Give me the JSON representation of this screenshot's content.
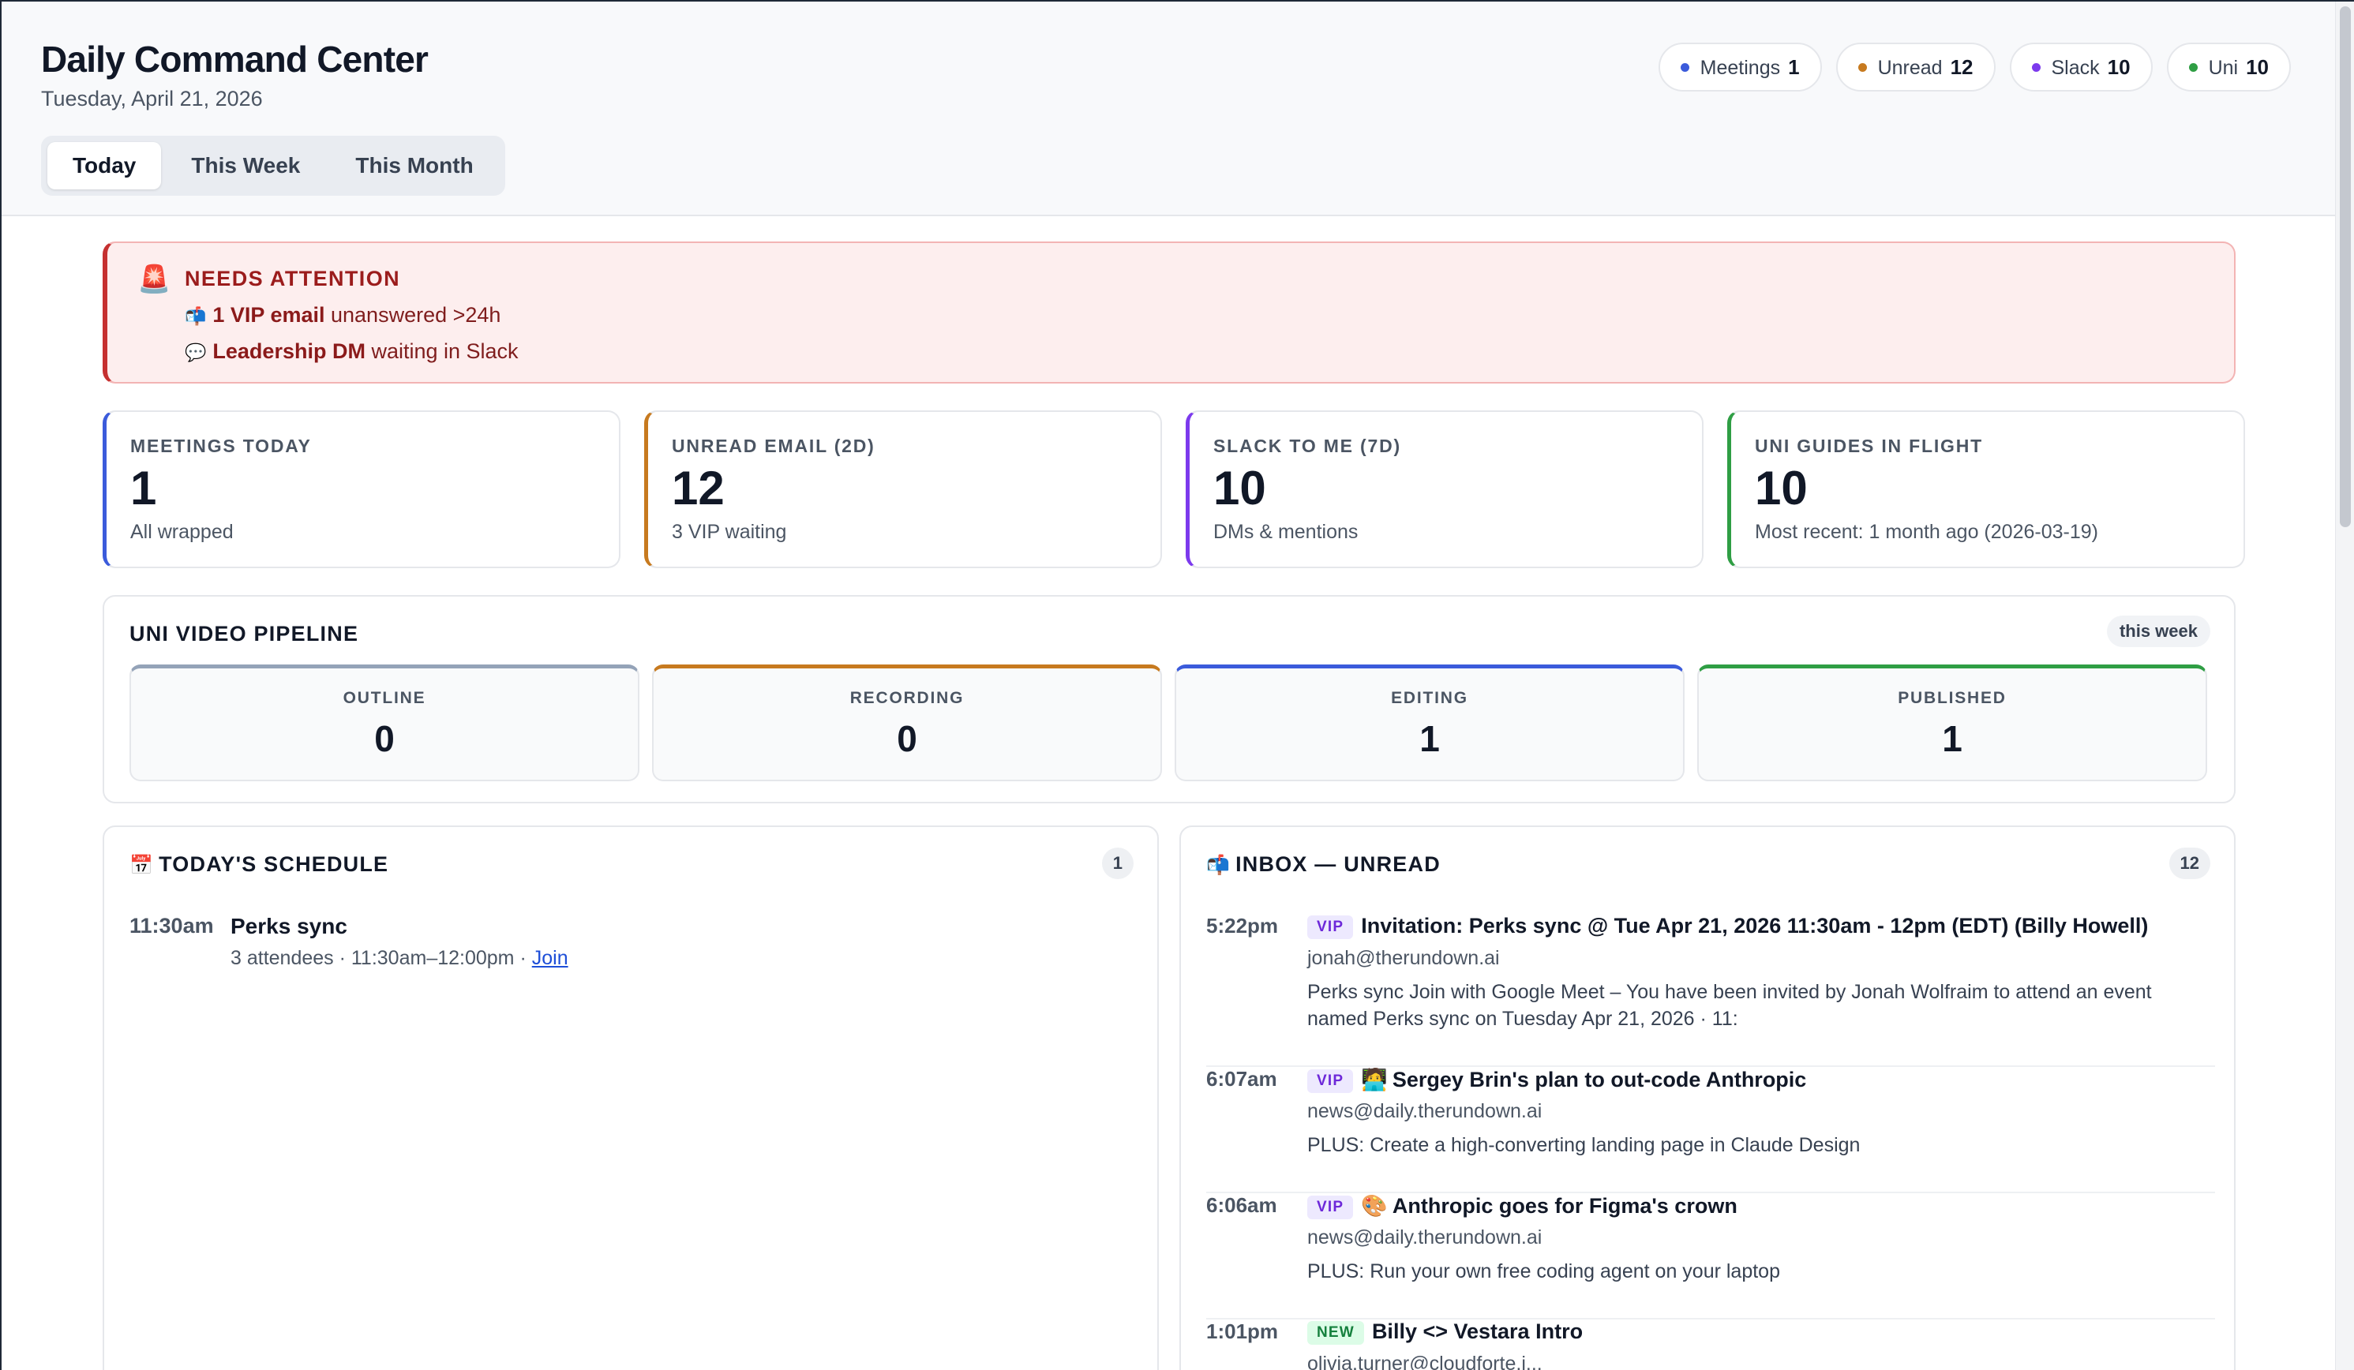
{
  "header": {
    "title": "Daily Command Center",
    "date": "Tuesday, April 21, 2026",
    "tabs": [
      {
        "label": "Today",
        "active": true
      },
      {
        "label": "This Week",
        "active": false
      },
      {
        "label": "This Month",
        "active": false
      }
    ],
    "pills": [
      {
        "label": "Meetings",
        "count": "1",
        "color": "#3b5bdb"
      },
      {
        "label": "Unread",
        "count": "12",
        "color": "#c77a1f"
      },
      {
        "label": "Slack",
        "count": "10",
        "color": "#7c3aed"
      },
      {
        "label": "Uni",
        "count": "10",
        "color": "#2f9e44"
      }
    ]
  },
  "alert": {
    "icon": "siren-icon",
    "title": "NEEDS ATTENTION",
    "lines": [
      {
        "icon": "mailbox-icon",
        "bold": "1 VIP email",
        "rest": " unanswered >24h"
      },
      {
        "icon": "speech-bubble-icon",
        "bold": "Leadership DM",
        "rest": " waiting in Slack"
      }
    ]
  },
  "metrics": [
    {
      "label": "MEETINGS TODAY",
      "value": "1",
      "sub": "All wrapped",
      "color": "#3b5bdb"
    },
    {
      "label": "UNREAD EMAIL (2D)",
      "value": "12",
      "sub": "3 VIP waiting",
      "color": "#c77a1f"
    },
    {
      "label": "SLACK TO ME (7D)",
      "value": "10",
      "sub": "DMs & mentions",
      "color": "#7c3aed"
    },
    {
      "label": "UNI GUIDES IN FLIGHT",
      "value": "10",
      "sub": "Most recent: 1 month ago (2026-03-19)",
      "color": "#2f9e44"
    }
  ],
  "pipeline": {
    "title": "UNI VIDEO PIPELINE",
    "tag": "this week",
    "stages": [
      {
        "label": "OUTLINE",
        "value": "0",
        "color": "#94a3b8"
      },
      {
        "label": "RECORDING",
        "value": "0",
        "color": "#c77a1f"
      },
      {
        "label": "EDITING",
        "value": "1",
        "color": "#3b5bdb"
      },
      {
        "label": "PUBLISHED",
        "value": "1",
        "color": "#2f9e44"
      }
    ]
  },
  "schedule": {
    "icon": "calendar-icon",
    "title": "TODAY'S SCHEDULE",
    "count": "1",
    "items": [
      {
        "time": "11:30am",
        "title": "Perks sync",
        "meta": "3 attendees · 11:30am–12:00pm · ",
        "link": "Join"
      }
    ]
  },
  "inbox": {
    "icon": "mailbox-icon",
    "title": "INBOX — UNREAD",
    "count": "12",
    "emails": [
      {
        "time": "5:22pm",
        "badge": "VIP",
        "emoji": "",
        "subject": "Invitation: Perks sync @ Tue Apr 21, 2026 11:30am - 12pm (EDT) (Billy Howell)",
        "from": "jonah@therundown.ai",
        "snippet": "Perks sync Join with Google Meet – You have been invited by Jonah Wolfraim to attend an event named Perks sync on Tuesday Apr 21, 2026 · 11:"
      },
      {
        "time": "6:07am",
        "badge": "VIP",
        "emoji": "🧑‍💻",
        "subject": "Sergey Brin's plan to out-code Anthropic",
        "from": "news@daily.therundown.ai",
        "snippet": "PLUS: Create a high-converting landing page in Claude Design"
      },
      {
        "time": "6:06am",
        "badge": "VIP",
        "emoji": "🎨",
        "subject": "Anthropic goes for Figma's crown",
        "from": "news@daily.therundown.ai",
        "snippet": "PLUS: Run your own free coding agent on your laptop"
      },
      {
        "time": "1:01pm",
        "badge": "NEW",
        "emoji": "",
        "subject": "Billy <> Vestara Intro",
        "from": "olivia.turner@cloudforte.i...",
        "snippet": ""
      }
    ]
  }
}
